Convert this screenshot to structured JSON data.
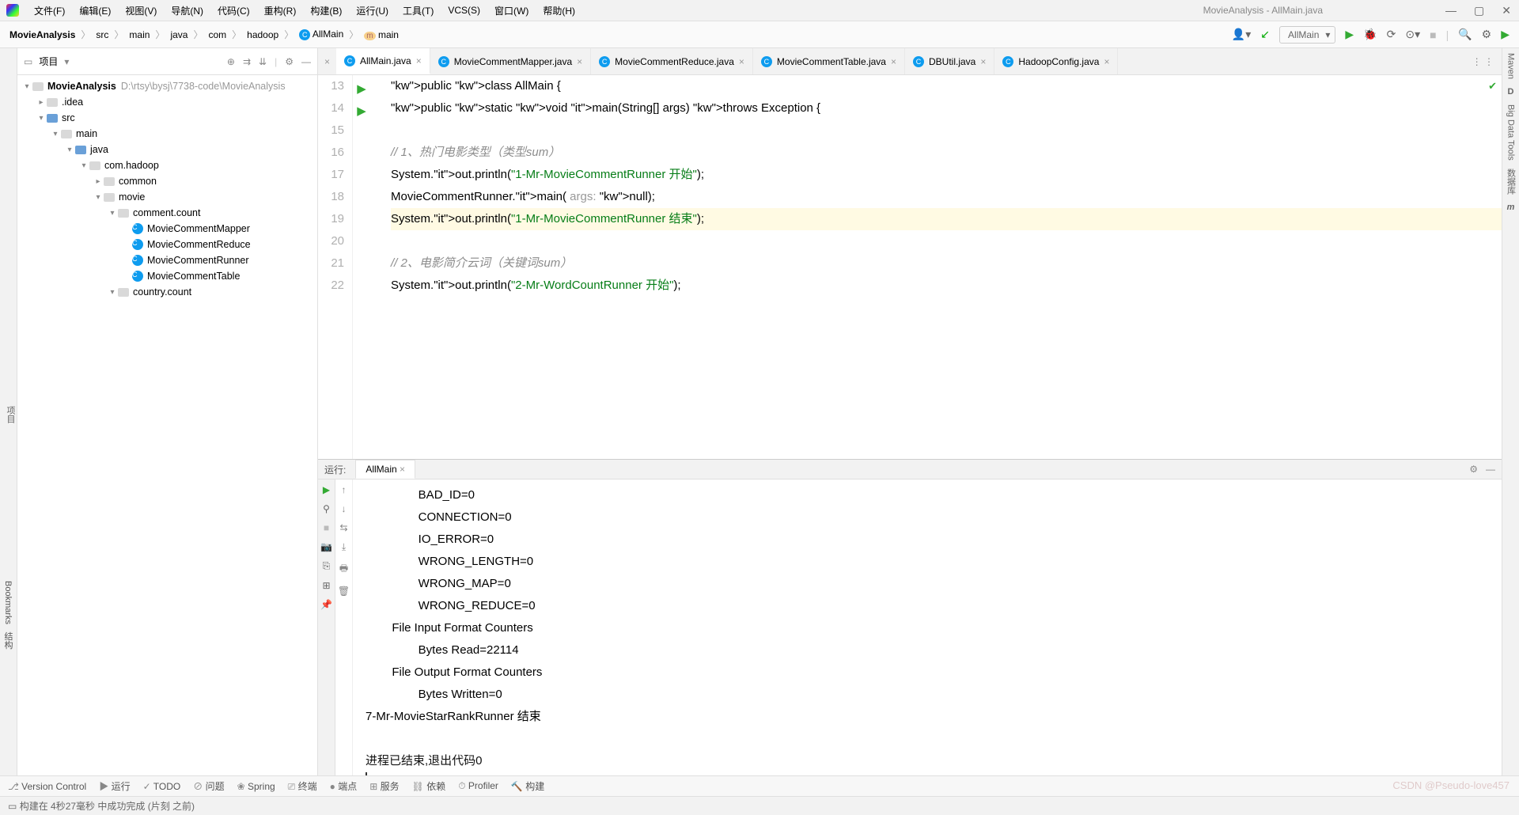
{
  "menu": {
    "items": [
      "文件(F)",
      "编辑(E)",
      "视图(V)",
      "导航(N)",
      "代码(C)",
      "重构(R)",
      "构建(B)",
      "运行(U)",
      "工具(T)",
      "VCS(S)",
      "窗口(W)",
      "帮助(H)"
    ],
    "title": "MovieAnalysis - AllMain.java"
  },
  "breadcrumbs": [
    "MovieAnalysis",
    "src",
    "main",
    "java",
    "com",
    "hadoop",
    "AllMain",
    "main"
  ],
  "runconfig": "AllMain",
  "project": {
    "header": "项目",
    "root": {
      "name": "MovieAnalysis",
      "path": "D:\\rtsy\\bysj\\7738-code\\MovieAnalysis"
    },
    "tree": [
      {
        "d": 1,
        "name": ".idea",
        "type": "folder"
      },
      {
        "d": 1,
        "name": "src",
        "type": "folder-blue",
        "open": true
      },
      {
        "d": 2,
        "name": "main",
        "type": "folder",
        "open": true
      },
      {
        "d": 3,
        "name": "java",
        "type": "folder-blue",
        "open": true
      },
      {
        "d": 4,
        "name": "com.hadoop",
        "type": "folder",
        "open": true
      },
      {
        "d": 5,
        "name": "common",
        "type": "folder"
      },
      {
        "d": 5,
        "name": "movie",
        "type": "folder",
        "open": true
      },
      {
        "d": 6,
        "name": "comment.count",
        "type": "folder",
        "open": true
      },
      {
        "d": 7,
        "name": "MovieCommentMapper",
        "type": "class"
      },
      {
        "d": 7,
        "name": "MovieCommentReduce",
        "type": "class"
      },
      {
        "d": 7,
        "name": "MovieCommentRunner",
        "type": "class"
      },
      {
        "d": 7,
        "name": "MovieCommentTable",
        "type": "class"
      },
      {
        "d": 6,
        "name": "country.count",
        "type": "folder",
        "open": true
      }
    ]
  },
  "tabs": [
    "AllMain.java",
    "MovieCommentMapper.java",
    "MovieCommentReduce.java",
    "MovieCommentTable.java",
    "DBUtil.java",
    "HadoopConfig.java"
  ],
  "activeTab": 0,
  "code": {
    "start": 13,
    "lines": [
      {
        "t": "public class AllMain {",
        "run": true
      },
      {
        "t": "    public static void main(String[] args) throws Exception {",
        "run": true
      },
      {
        "t": ""
      },
      {
        "t": "        // 1、热门电影类型（类型sum）",
        "cm": true
      },
      {
        "t": "        System.out.println(\"1-Mr-MovieCommentRunner 开始\");"
      },
      {
        "t": "        MovieCommentRunner.main( args: null);"
      },
      {
        "t": "        System.out.println(\"1-Mr-MovieCommentRunner 结束\");",
        "hl": true
      },
      {
        "t": ""
      },
      {
        "t": "        // 2、电影简介云词（关键词sum）",
        "cm": true
      },
      {
        "t": "        System.out.println(\"2-Mr-WordCountRunner 开始\");"
      }
    ]
  },
  "runtab": {
    "label": "运行:",
    "title": "AllMain"
  },
  "console": [
    "                BAD_ID=0",
    "                CONNECTION=0",
    "                IO_ERROR=0",
    "                WRONG_LENGTH=0",
    "                WRONG_MAP=0",
    "                WRONG_REDUCE=0",
    "        File Input Format Counters",
    "                Bytes Read=22114",
    "        File Output Format Counters",
    "                Bytes Written=0",
    "7-Mr-MovieStarRankRunner 结束",
    "",
    "进程已结束,退出代码0"
  ],
  "bottombar": [
    "Version Control",
    "运行",
    "TODO",
    "问题",
    "Spring",
    "终端",
    "端点",
    "服务",
    "依赖",
    "Profiler",
    "构建"
  ],
  "status": "构建在 4秒27毫秒 中成功完成 (片刻 之前)",
  "sidebars": {
    "left": "项目",
    "leftb": "结构",
    "leftbm": "Bookmarks",
    "right1": "Maven",
    "right2": "Big Data Tools",
    "right3": "数据库",
    "right4": "m"
  },
  "watermark": "CSDN @Pseudo-love457"
}
